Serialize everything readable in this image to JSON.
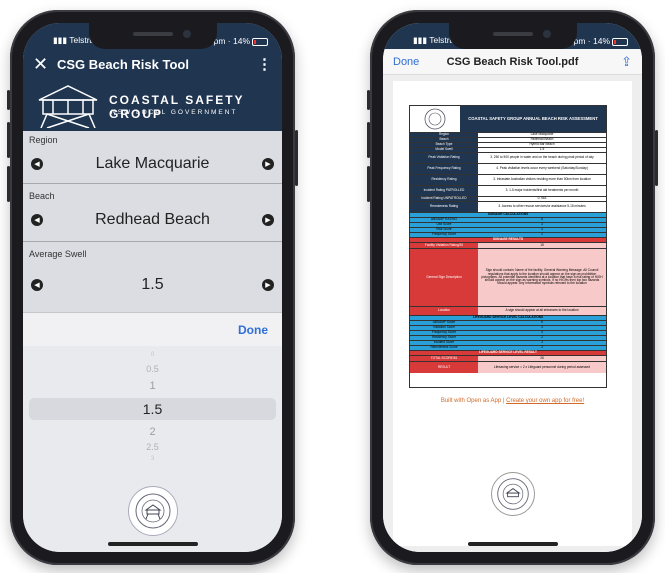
{
  "left_phone": {
    "status": {
      "carrier": "Telstra #LetsVaxx",
      "network": "4G",
      "time": "1:44 pm",
      "battery": "14%"
    },
    "app_bar": {
      "title": "CSG Beach Risk Tool"
    },
    "banner": {
      "name": "COASTAL SAFETY GROUP",
      "sub": "NSW LOCAL GOVERNMENT"
    },
    "fields": [
      {
        "label": "Region",
        "value": "Lake Macquarie"
      },
      {
        "label": "Beach",
        "value": "Redhead Beach"
      },
      {
        "label": "Average Swell",
        "value": "1.5"
      }
    ],
    "done_label": "Done",
    "picker": {
      "options": [
        "0",
        "0.5",
        "1",
        "1.5",
        "2",
        "2.5",
        "3"
      ],
      "selected": "1.5"
    }
  },
  "right_phone": {
    "status": {
      "carrier": "Telstra #LetsVaxx",
      "network": "4G",
      "time": "1:44 pm",
      "battery": "14%"
    },
    "nav": {
      "done": "Done",
      "title": "CSG Beach Risk Tool.pdf"
    },
    "doc": {
      "title": "COASTAL SAFETY GROUP ANNUAL BEACH RISK ASSESSMENT",
      "info_rows": [
        {
          "k": "Region",
          "v": "Lake Macquarie"
        },
        {
          "k": "Beach",
          "v": "Redhead Beach"
        },
        {
          "k": "Beach Type",
          "v": "Hybrid Bar Beach"
        },
        {
          "k": "Model Swell",
          "v": "1.5"
        },
        {
          "k": "Peak Visitation Rating",
          "v": "3. 250 to 500 people in water and on the beach during peak period of day"
        },
        {
          "k": "Peak Frequency Rating",
          "v": "4. Peak visitation levels occur every weekend (Saturday/Sunday)"
        },
        {
          "k": "Residency Rating",
          "v": "3. Intrastate Australian visitors residing more than 50km from location"
        },
        {
          "k": "Incident Rating PATROLLED",
          "v": "3. 1-5 major incidents/first aid treatments per month"
        },
        {
          "k": "Incident Rating UNPATROLLED",
          "v": "0. N/A"
        },
        {
          "k": "Remoteness Rating",
          "v": "3. Access to other rescue services/or assistance 5-15 minutes"
        }
      ],
      "signage_calc_header": "SIGNAGE CALCULATIONS",
      "signage_calc": [
        {
          "k": "ABSAMP RATING",
          "v": "6"
        },
        {
          "k": "Use Score",
          "v": "3"
        },
        {
          "k": "Risk Score",
          "v": "4"
        },
        {
          "k": "Frequency Score",
          "v": "2"
        }
      ],
      "signage_results_header": "SIGNAGE RESULTS",
      "signage_results": [
        {
          "k": "Facility Visitation Rating/30",
          "v": "15"
        }
      ],
      "general_sign": {
        "k": "General Sign Description",
        "v": "Sign should contain: Name of the facility. General Warning Message. All Council regulations that apply to the location should appear on the sign as prohibition pictograms. All potential hazards identified at a location that have a risk rating of HIGH should appear on the sign as warning symbols. If no HIGHs then top two hazards should appear. Any Information symbols relevant to the location"
      },
      "location_row": {
        "k": "Location",
        "v": "A sign should appear at all entrances to the location"
      },
      "lifeguard_calc_header": "LIFEGUARD SERVICE LEVEL CALCULATIONS",
      "lifeguard_calc": [
        {
          "k": "ABSAMP Score",
          "v": "6"
        },
        {
          "k": "Visitation Score",
          "v": "3"
        },
        {
          "k": "Frequency Score",
          "v": "4"
        },
        {
          "k": "Residency Score",
          "v": "2"
        },
        {
          "k": "Incident Score",
          "v": "3"
        },
        {
          "k": "Remoteness Score",
          "v": "3"
        }
      ],
      "lifeguard_result_header": "LIFEGUARD SERVICE LEVEL RESULT",
      "lifeguard_result": [
        {
          "k": "TOTAL SCORE/51",
          "v": "26"
        },
        {
          "k": "RESULT",
          "v": "Lifesaving service = 2 x Lifeguard personnel during period assessed"
        }
      ]
    },
    "footer": {
      "prefix": "Built with Open as App | ",
      "link": "Create your own app for free!"
    }
  }
}
